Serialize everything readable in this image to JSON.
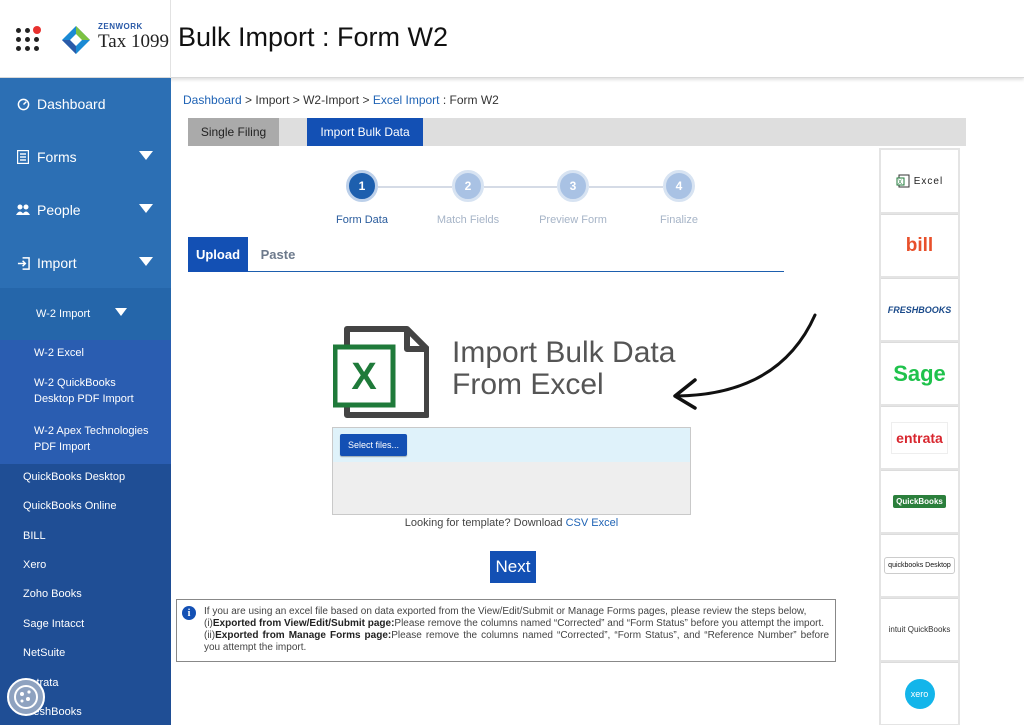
{
  "header": {
    "brand_small": "ZENWORK",
    "brand_name": "Tax 1099",
    "page_title": "Bulk Import : Form W2"
  },
  "sidebar": {
    "items": [
      {
        "label": "Dashboard",
        "icon": "dashboard-icon"
      },
      {
        "label": "Forms",
        "icon": "forms-icon"
      },
      {
        "label": "People",
        "icon": "people-icon"
      },
      {
        "label": "Import",
        "icon": "import-icon"
      }
    ],
    "import_sub": "W-2 Import",
    "w2_links": [
      "W-2 Excel",
      "W-2 QuickBooks Desktop PDF Import",
      "W-2 Apex Technologies PDF Import"
    ],
    "sources": [
      "QuickBooks Desktop",
      "QuickBooks Online",
      "BILL",
      "Xero",
      "Zoho Books",
      "Sage Intacct",
      "NetSuite",
      "Entrata",
      "FreshBooks"
    ]
  },
  "breadcrumb": {
    "dashboard": "Dashboard",
    "sep": " > ",
    "import": "Import",
    "w2_import": "W2-Import",
    "excel_import": "Excel Import",
    "current": " : Form W2"
  },
  "tabs": {
    "single": "Single Filing",
    "bulk": "Import Bulk Data"
  },
  "stepper": {
    "steps": [
      {
        "num": "1",
        "label": "Form Data"
      },
      {
        "num": "2",
        "label": "Match Fields"
      },
      {
        "num": "3",
        "label": "Preview Form"
      },
      {
        "num": "4",
        "label": "Finalize"
      }
    ]
  },
  "upload_tabs": {
    "upload": "Upload",
    "paste": "Paste"
  },
  "import_art": {
    "file_letter": "X",
    "line1": "Import Bulk Data",
    "line2": "From Excel"
  },
  "dropzone": {
    "select_button": "Select files..."
  },
  "template": {
    "prefix": "Looking for template? Download",
    "csv": "CSV",
    "excel": "Excel"
  },
  "next_button": "Next",
  "info": {
    "icon_glyph": "i",
    "intro": "If you are using an excel file based on data exported from the View/Edit/Submit or Manage Forms pages, please review the steps below,",
    "step1_prefix": "(i)",
    "step1_title": "Exported from View/Edit/Submit page:",
    "step1_text": "Please remove the columns named “Corrected” and “Form Status” before you attempt the import.",
    "step2_prefix": "(ii)",
    "step2_title": "Exported from Manage Forms page:",
    "step2_text": "Please remove the columns named “Corrected”, “Form Status”, and “Reference Number” before you attempt the import."
  },
  "integrations": {
    "excel": "Excel",
    "excel_letter": "X",
    "bill": "bill",
    "freshbooks": "FRESHBOOKS",
    "sage": "Sage",
    "entrata": "entrata",
    "quickbooks": "QuickBooks",
    "qb_desktop": "quickbooks Desktop",
    "intuit_qb": "intuit QuickBooks",
    "xero": "xero"
  },
  "colors": {
    "sidebar": "#2c6fb4",
    "primary": "#1350b4",
    "link": "#1f63b5",
    "excel_green": "#1f7a3a"
  }
}
